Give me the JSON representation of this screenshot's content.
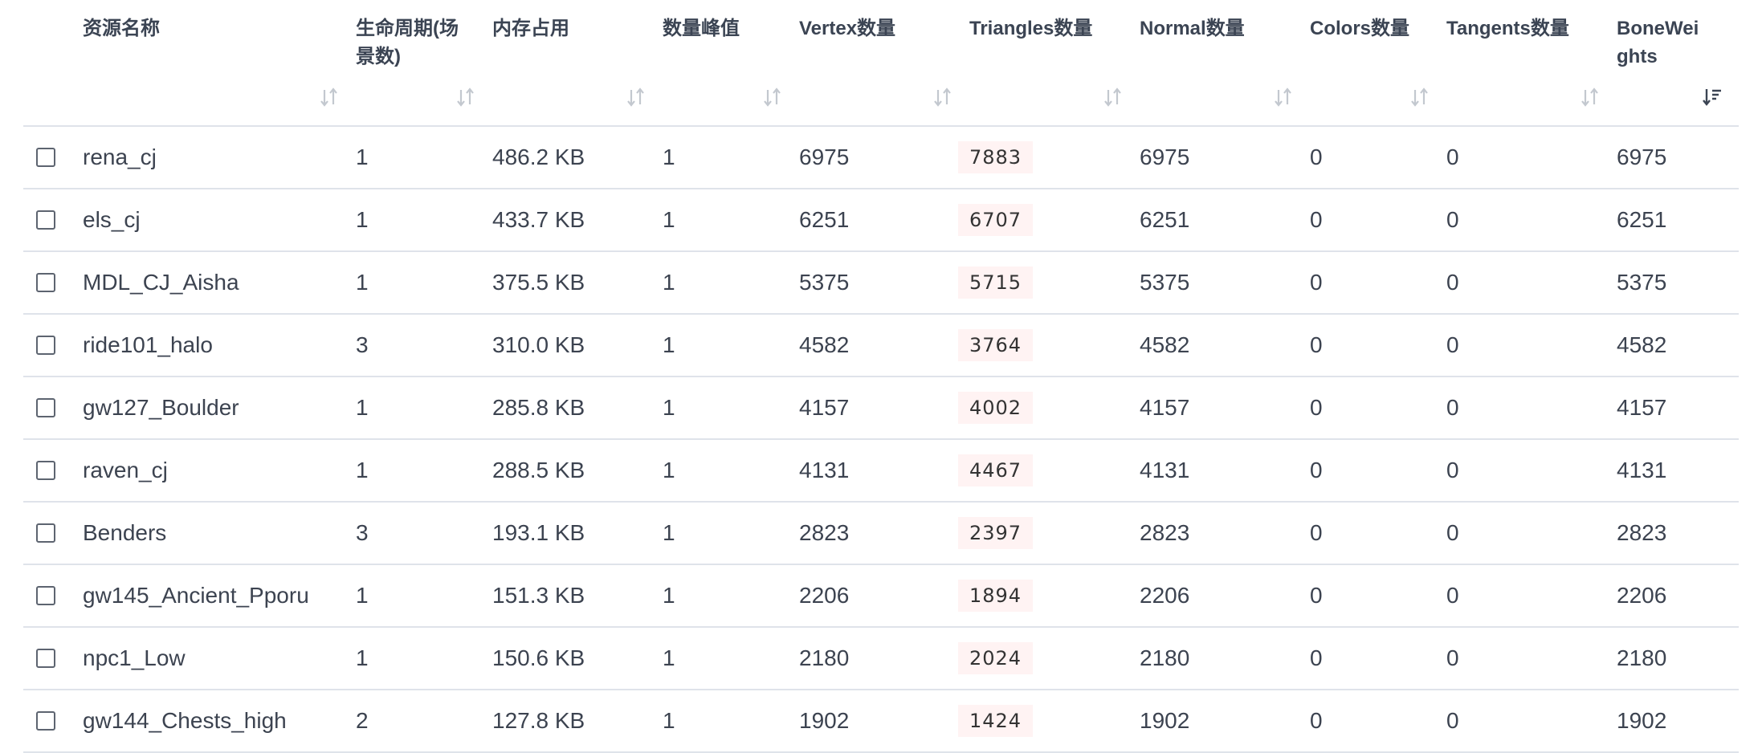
{
  "table": {
    "columns": [
      {
        "label": "资源名称"
      },
      {
        "label": "生命周期(场景数)"
      },
      {
        "label": "内存占用"
      },
      {
        "label": "数量峰值"
      },
      {
        "label": "Vertex数量"
      },
      {
        "label": "Triangles数量"
      },
      {
        "label": "Normal数量"
      },
      {
        "label": "Colors数量"
      },
      {
        "label": "Tangents数量"
      },
      {
        "label": "BoneWeights"
      }
    ],
    "sort_icons": [
      "sort-both-icon",
      "sort-both-icon",
      "sort-both-icon",
      "sort-both-icon",
      "sort-both-icon",
      "sort-both-icon",
      "sort-both-icon",
      "sort-both-icon",
      "sort-both-icon",
      "sort-descending-icon"
    ],
    "rows": [
      {
        "name": "rena_cj",
        "lifecycle": "1",
        "memory": "486.2 KB",
        "peak": "1",
        "vertex": "6975",
        "triangles": "7883",
        "normal": "6975",
        "colors": "0",
        "tangents": "0",
        "boneweights": "6975"
      },
      {
        "name": "els_cj",
        "lifecycle": "1",
        "memory": "433.7 KB",
        "peak": "1",
        "vertex": "6251",
        "triangles": "6707",
        "normal": "6251",
        "colors": "0",
        "tangents": "0",
        "boneweights": "6251"
      },
      {
        "name": "MDL_CJ_Aisha",
        "lifecycle": "1",
        "memory": "375.5 KB",
        "peak": "1",
        "vertex": "5375",
        "triangles": "5715",
        "normal": "5375",
        "colors": "0",
        "tangents": "0",
        "boneweights": "5375"
      },
      {
        "name": "ride101_halo",
        "lifecycle": "3",
        "memory": "310.0 KB",
        "peak": "1",
        "vertex": "4582",
        "triangles": "3764",
        "normal": "4582",
        "colors": "0",
        "tangents": "0",
        "boneweights": "4582"
      },
      {
        "name": "gw127_Boulder",
        "lifecycle": "1",
        "memory": "285.8 KB",
        "peak": "1",
        "vertex": "4157",
        "triangles": "4002",
        "normal": "4157",
        "colors": "0",
        "tangents": "0",
        "boneweights": "4157"
      },
      {
        "name": "raven_cj",
        "lifecycle": "1",
        "memory": "288.5 KB",
        "peak": "1",
        "vertex": "4131",
        "triangles": "4467",
        "normal": "4131",
        "colors": "0",
        "tangents": "0",
        "boneweights": "4131"
      },
      {
        "name": "Benders",
        "lifecycle": "3",
        "memory": "193.1 KB",
        "peak": "1",
        "vertex": "2823",
        "triangles": "2397",
        "normal": "2823",
        "colors": "0",
        "tangents": "0",
        "boneweights": "2823"
      },
      {
        "name": "gw145_Ancient_Pporu",
        "lifecycle": "1",
        "memory": "151.3 KB",
        "peak": "1",
        "vertex": "2206",
        "triangles": "1894",
        "normal": "2206",
        "colors": "0",
        "tangents": "0",
        "boneweights": "2206"
      },
      {
        "name": "npc1_Low",
        "lifecycle": "1",
        "memory": "150.6 KB",
        "peak": "1",
        "vertex": "2180",
        "triangles": "2024",
        "normal": "2180",
        "colors": "0",
        "tangents": "0",
        "boneweights": "2180"
      },
      {
        "name": "gw144_Chests_high",
        "lifecycle": "2",
        "memory": "127.8 KB",
        "peak": "1",
        "vertex": "1902",
        "triangles": "1424",
        "normal": "1902",
        "colors": "0",
        "tangents": "0",
        "boneweights": "1902"
      }
    ]
  }
}
